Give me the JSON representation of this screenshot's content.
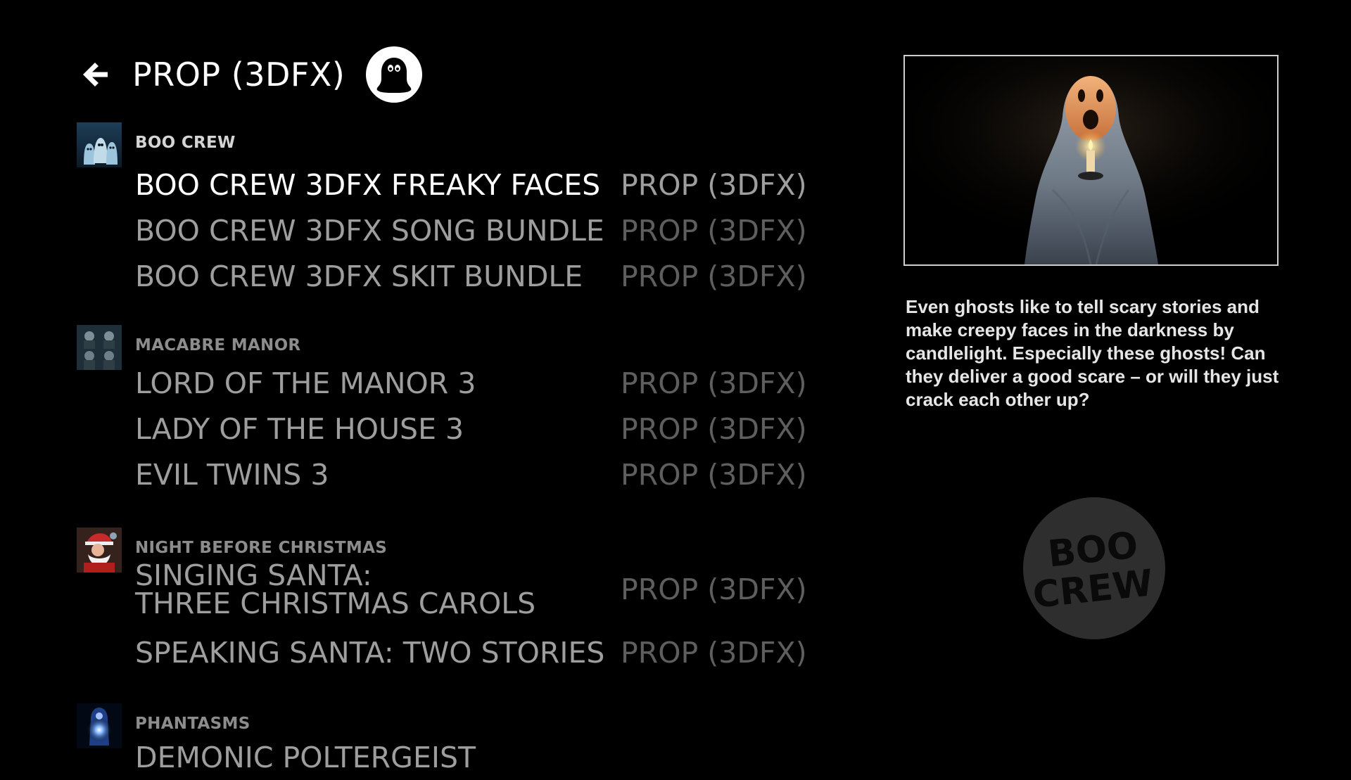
{
  "header": {
    "title": "PROP (3DFX)"
  },
  "groups": [
    {
      "label": "BOO CREW",
      "items": [
        {
          "name": "BOO CREW 3DFX FREAKY FACES",
          "type": "PROP (3DFX)"
        },
        {
          "name": "BOO CREW 3DFX SONG BUNDLE",
          "type": "PROP (3DFX)"
        },
        {
          "name": "BOO CREW 3DFX SKIT BUNDLE",
          "type": "PROP (3DFX)"
        }
      ]
    },
    {
      "label": "MACABRE MANOR",
      "items": [
        {
          "name": "LORD OF THE MANOR 3",
          "type": "PROP (3DFX)"
        },
        {
          "name": "LADY OF THE HOUSE 3",
          "type": "PROP (3DFX)"
        },
        {
          "name": "EVIL TWINS 3",
          "type": "PROP (3DFX)"
        }
      ]
    },
    {
      "label": "NIGHT BEFORE CHRISTMAS",
      "items": [
        {
          "name_line1": "SINGING SANTA:",
          "name_line2": "THREE CHRISTMAS CAROLS",
          "type": "PROP (3DFX)"
        },
        {
          "name": "SPEAKING SANTA: TWO STORIES",
          "type": "PROP (3DFX)"
        }
      ]
    },
    {
      "label": "PHANTASMS",
      "items": [
        {
          "name": "DEMONIC POLTERGEIST"
        }
      ]
    }
  ],
  "detail": {
    "description": "Even ghosts like to tell scary stories and make creepy faces in the darkness by candlelight. Especially these ghosts! Can they deliver a good scare – or will they just crack each other up?",
    "logo_text_line1": "BOO",
    "logo_text_line2": "CREW"
  },
  "icons": {
    "back": "arrow-left-icon",
    "type": "ghost-icon"
  },
  "colors": {
    "background": "#000000",
    "focused_text": "#ffffff",
    "item_text": "#9e9e9e",
    "type_text": "#5e5e5e",
    "logo_bg": "#2e2e2e"
  }
}
